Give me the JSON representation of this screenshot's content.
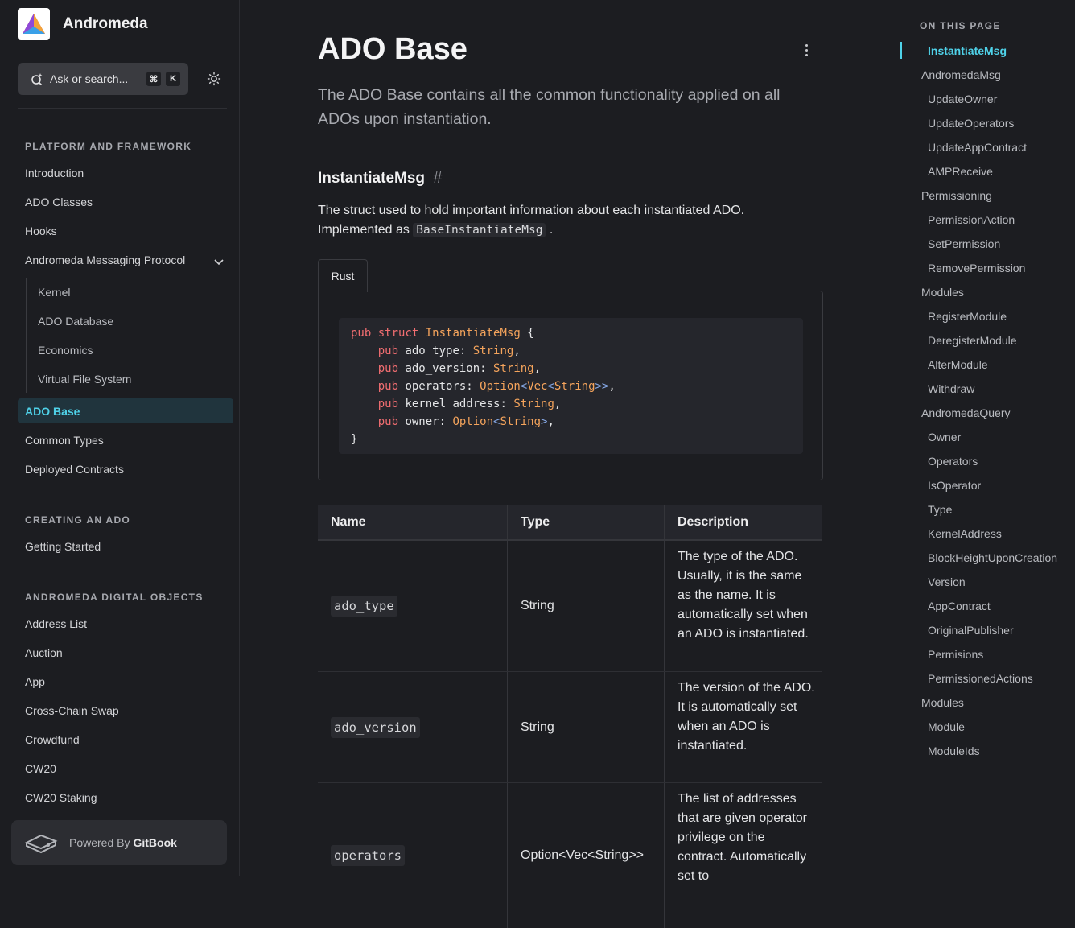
{
  "brand": {
    "name": "Andromeda"
  },
  "search": {
    "placeholder": "Ask or search...",
    "kbd_cmd": "⌘",
    "kbd_key": "K"
  },
  "sidebar": {
    "sections": [
      {
        "title": "PLATFORM AND FRAMEWORK"
      },
      {
        "title": "CREATING AN ADO"
      },
      {
        "title": "ANDROMEDA DIGITAL OBJECTS"
      }
    ],
    "platform_items": [
      "Introduction",
      "ADO Classes",
      "Hooks",
      "Andromeda Messaging Protocol"
    ],
    "amp_children": [
      "Kernel",
      "ADO Database",
      "Economics",
      "Virtual File System"
    ],
    "active_item": "ADO Base",
    "platform_tail": [
      "Common Types",
      "Deployed Contracts"
    ],
    "creating_items": [
      "Getting Started"
    ],
    "ado_items": [
      "Address List",
      "Auction",
      "App",
      "Cross-Chain Swap",
      "Crowdfund",
      "CW20",
      "CW20 Staking"
    ],
    "footer": {
      "prefix": "Powered By",
      "brand": "GitBook"
    }
  },
  "main": {
    "title": "ADO Base",
    "lead": "The ADO Base contains all the common functionality applied on all ADOs upon instantiation.",
    "section_heading": "InstantiateMsg",
    "section_hash": "#",
    "para_text": "The struct used to hold important information about each instantiated ADO. Implemented as",
    "para_code": "BaseInstantiateMsg",
    "para_end": ".",
    "code_tab": "Rust",
    "table": {
      "headers": [
        "Name",
        "Type",
        "Description"
      ],
      "rows": [
        {
          "name": "ado_type",
          "type": "String",
          "description": "The type of the ADO. Usually, it is the same as the name. It is automatically set when an ADO is instantiated."
        },
        {
          "name": "ado_version",
          "type": "String",
          "description": "The version of the ADO. It is automatically set when an ADO is instantiated."
        },
        {
          "name": "operators",
          "type": "Option<Vec<String>>",
          "description": "The list of addresses that are given operator privilege  on the contract. Automatically set to"
        }
      ]
    }
  },
  "toc": {
    "title": "ON THIS PAGE",
    "items": [
      {
        "label": "InstantiateMsg",
        "level": 1,
        "active": true
      },
      {
        "label": "AndromedaMsg",
        "level": 0
      },
      {
        "label": "UpdateOwner",
        "level": 1
      },
      {
        "label": "UpdateOperators",
        "level": 1
      },
      {
        "label": "UpdateAppContract",
        "level": 1
      },
      {
        "label": "AMPReceive",
        "level": 1
      },
      {
        "label": "Permissioning",
        "level": 0
      },
      {
        "label": "PermissionAction",
        "level": 1
      },
      {
        "label": "SetPermission",
        "level": 1
      },
      {
        "label": "RemovePermission",
        "level": 1
      },
      {
        "label": "Modules",
        "level": 0
      },
      {
        "label": "RegisterModule",
        "level": 1
      },
      {
        "label": "DeregisterModule",
        "level": 1
      },
      {
        "label": "AlterModule",
        "level": 1
      },
      {
        "label": "Withdraw",
        "level": 1
      },
      {
        "label": "AndromedaQuery",
        "level": 0
      },
      {
        "label": "Owner",
        "level": 1
      },
      {
        "label": "Operators",
        "level": 1
      },
      {
        "label": "IsOperator",
        "level": 1
      },
      {
        "label": "Type",
        "level": 1
      },
      {
        "label": "KernelAddress",
        "level": 1
      },
      {
        "label": "BlockHeightUponCreation",
        "level": 1
      },
      {
        "label": "Version",
        "level": 1
      },
      {
        "label": "AppContract",
        "level": 1
      },
      {
        "label": "OriginalPublisher",
        "level": 1
      },
      {
        "label": "Permisions",
        "level": 1
      },
      {
        "label": "PermissionedActions",
        "level": 1
      },
      {
        "label": "Modules",
        "level": 0
      },
      {
        "label": "Module",
        "level": 1
      },
      {
        "label": "ModuleIds",
        "level": 1
      }
    ]
  },
  "colors": {
    "accent": "#4fd2e9",
    "background": "#1c1d21",
    "keyword": "#f26e71",
    "type": "#f5a45c"
  }
}
